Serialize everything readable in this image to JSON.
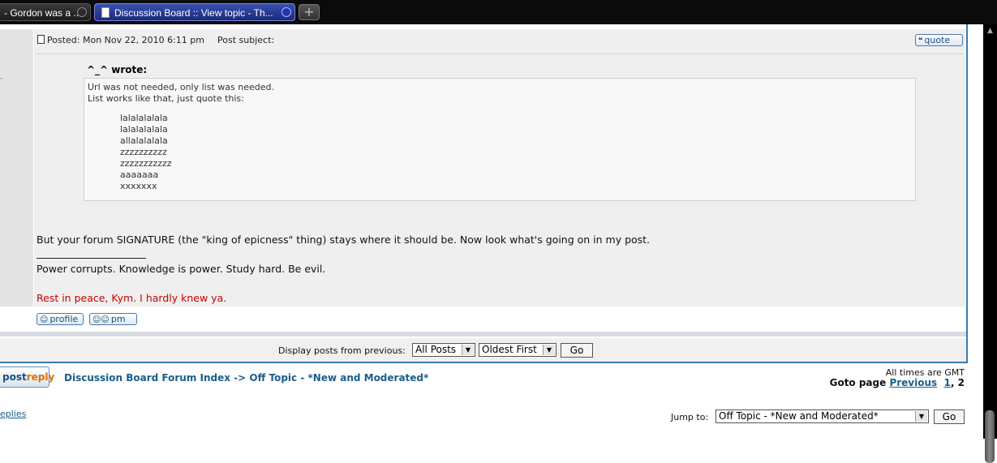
{
  "browser": {
    "tabs": [
      {
        "title": "- Gordon was a ..."
      },
      {
        "title": "Discussion Board :: View topic - Th..."
      }
    ],
    "new_tab_glyph": "+"
  },
  "post": {
    "posted_label": "Posted: Mon Nov 22, 2010 6:11 pm",
    "subject_label": "Post subject:",
    "quote_button": "quote",
    "quote": {
      "author": "^_^ wrote:",
      "lines": [
        "Url was not needed, only list was needed.",
        "List works like that, just quote this:"
      ],
      "list_items": [
        "lalalalalala",
        "lalalalalala",
        "allalalalala",
        "zzzzzzzzzz",
        "zzzzzzzzzzz",
        "aaaaaaa",
        "xxxxxxx"
      ]
    },
    "body_text": "But your forum SIGNATURE (the \"king of epicness\" thing) stays where it should be. Now look what's going on in my post.",
    "signature_line1": "Power corrupts. Knowledge is power. Study hard. Be evil.",
    "signature_line2": "Rest in peace, Kym. I hardly knew ya.",
    "profile_button": "profile",
    "pm_button": "pm"
  },
  "display_bar": {
    "label": "Display posts from previous:",
    "days_select": "All Posts",
    "order_select": "Oldest First",
    "go": "Go"
  },
  "nav": {
    "postreply_post": "post",
    "postreply_reply": "reply",
    "forum_index": "Discussion Board Forum Index",
    "separator": "->",
    "forum": "Off Topic - *New and Moderated*",
    "times": "All times are GMT",
    "goto_label": "Goto page",
    "previous": "Previous",
    "page1": "1",
    "comma": ",",
    "page2": "2",
    "replies_link": "eplies",
    "jump_label": "Jump to:",
    "jump_select": "Off Topic - *New and Moderated*",
    "jump_go": "Go"
  },
  "colors": {
    "link": "#1a5e8a",
    "signature_red": "#c80000",
    "frame_blue": "#3a7ba8"
  },
  "icons": {
    "post": "post-icon",
    "quote": "speech-bubble-icon",
    "profile": "user-icon",
    "pm": "two-users-icon"
  }
}
